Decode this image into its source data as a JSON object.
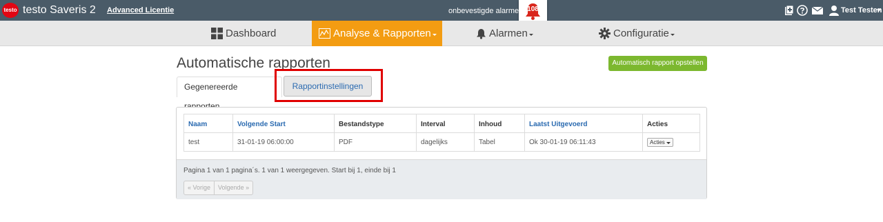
{
  "app": {
    "logo_text": "testo",
    "title": "testo Saveris 2",
    "license": "Advanced Licentie",
    "alarms_label": "onbevestigde alarmen",
    "alarm_count": "108",
    "user": "Test Testen"
  },
  "nav": {
    "items": [
      {
        "label": "Dashboard",
        "icon": "dashboard-icon",
        "active": false
      },
      {
        "label": "Analyse & Rapporten",
        "icon": "chart-icon",
        "active": true
      },
      {
        "label": "Alarmen",
        "icon": "bell-icon",
        "active": false
      },
      {
        "label": "Configuratie",
        "icon": "gear-icon",
        "active": false
      }
    ]
  },
  "page": {
    "title": "Automatische rapporten",
    "create_button": "Automatisch rapport opstellen",
    "tabs": [
      "Gegenereerde rapporten",
      "Rapportinstellingen"
    ]
  },
  "table": {
    "headers": [
      "Naam",
      "Volgende Start",
      "Bestandstype",
      "Interval",
      "Inhoud",
      "Laatst Uitgevoerd",
      "Acties"
    ],
    "rows": [
      [
        "test",
        "31-01-19 06:00:00",
        "PDF",
        "dagelijks",
        "Tabel",
        "Ok 30-01-19 06:11:43",
        "Acties"
      ]
    ]
  },
  "paging": {
    "info": "Pagina 1 van 1 pagina´s. 1 van 1 weergegeven. Start bij 1, einde bij 1",
    "prev": "« Vorige",
    "next": "Volgende »"
  },
  "colors": {
    "topbar": "#4a5b68",
    "active_nav": "#f39c12",
    "create_button": "#7cb82f",
    "highlight": "#e00000",
    "link": "#2a6ab0"
  }
}
